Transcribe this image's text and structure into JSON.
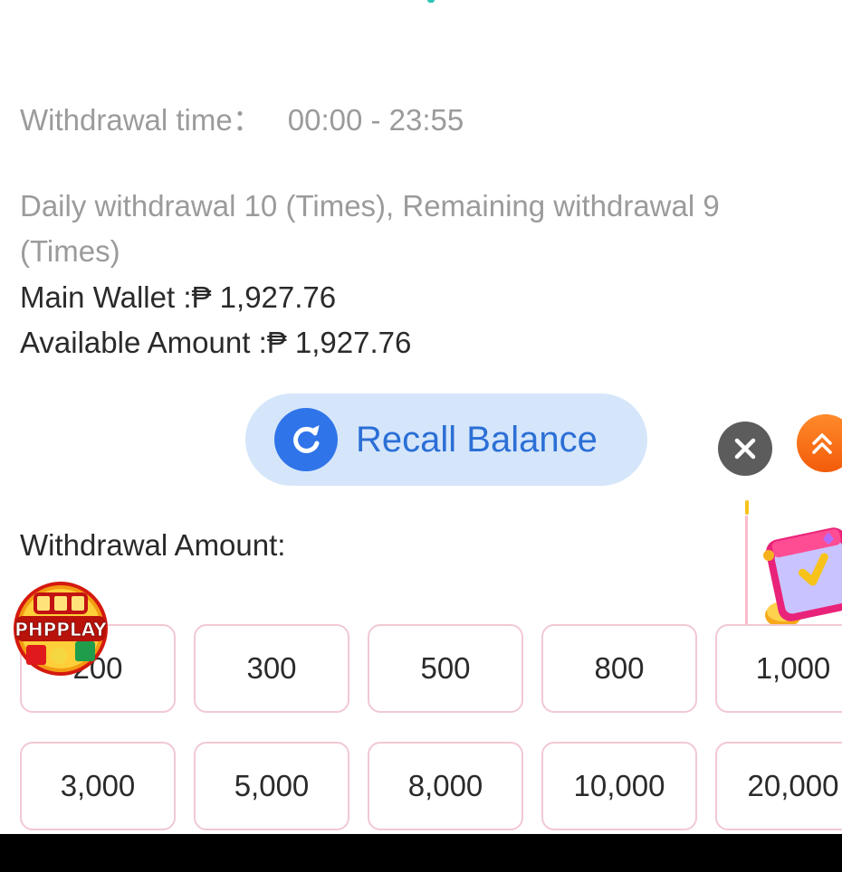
{
  "withdrawal_time": {
    "label": "Withdrawal time：",
    "value": "00:00 - 23:55"
  },
  "daily_info": {
    "line1": "Daily withdrawal 10 (Times), Remaining withdrawal 9",
    "line2": "(Times)"
  },
  "main_wallet": "Main Wallet :₱ 1,927.76",
  "available_amount": "Available Amount :₱ 1,927.76",
  "recall_button": {
    "label": "Recall Balance",
    "icon": "refresh-icon"
  },
  "floating_controls": {
    "close_icon": "close-icon",
    "scroll_top_icon": "double-chevron-up-icon"
  },
  "withdrawal_amount_label": "Withdrawal Amount:",
  "amount_options_row1": [
    "200",
    "300",
    "500",
    "800",
    "1,000"
  ],
  "amount_options_row2": [
    "3,000",
    "5,000",
    "8,000",
    "10,000",
    "20,000"
  ],
  "game_badge": {
    "logo_text": "PHPPLAY"
  },
  "colors": {
    "muted_text": "#9b9b9b",
    "recall_bg": "#d5e6fb",
    "recall_accent": "#2f74e8",
    "amount_border": "#f1c9d3",
    "scroll_top": "#f25c0a"
  }
}
